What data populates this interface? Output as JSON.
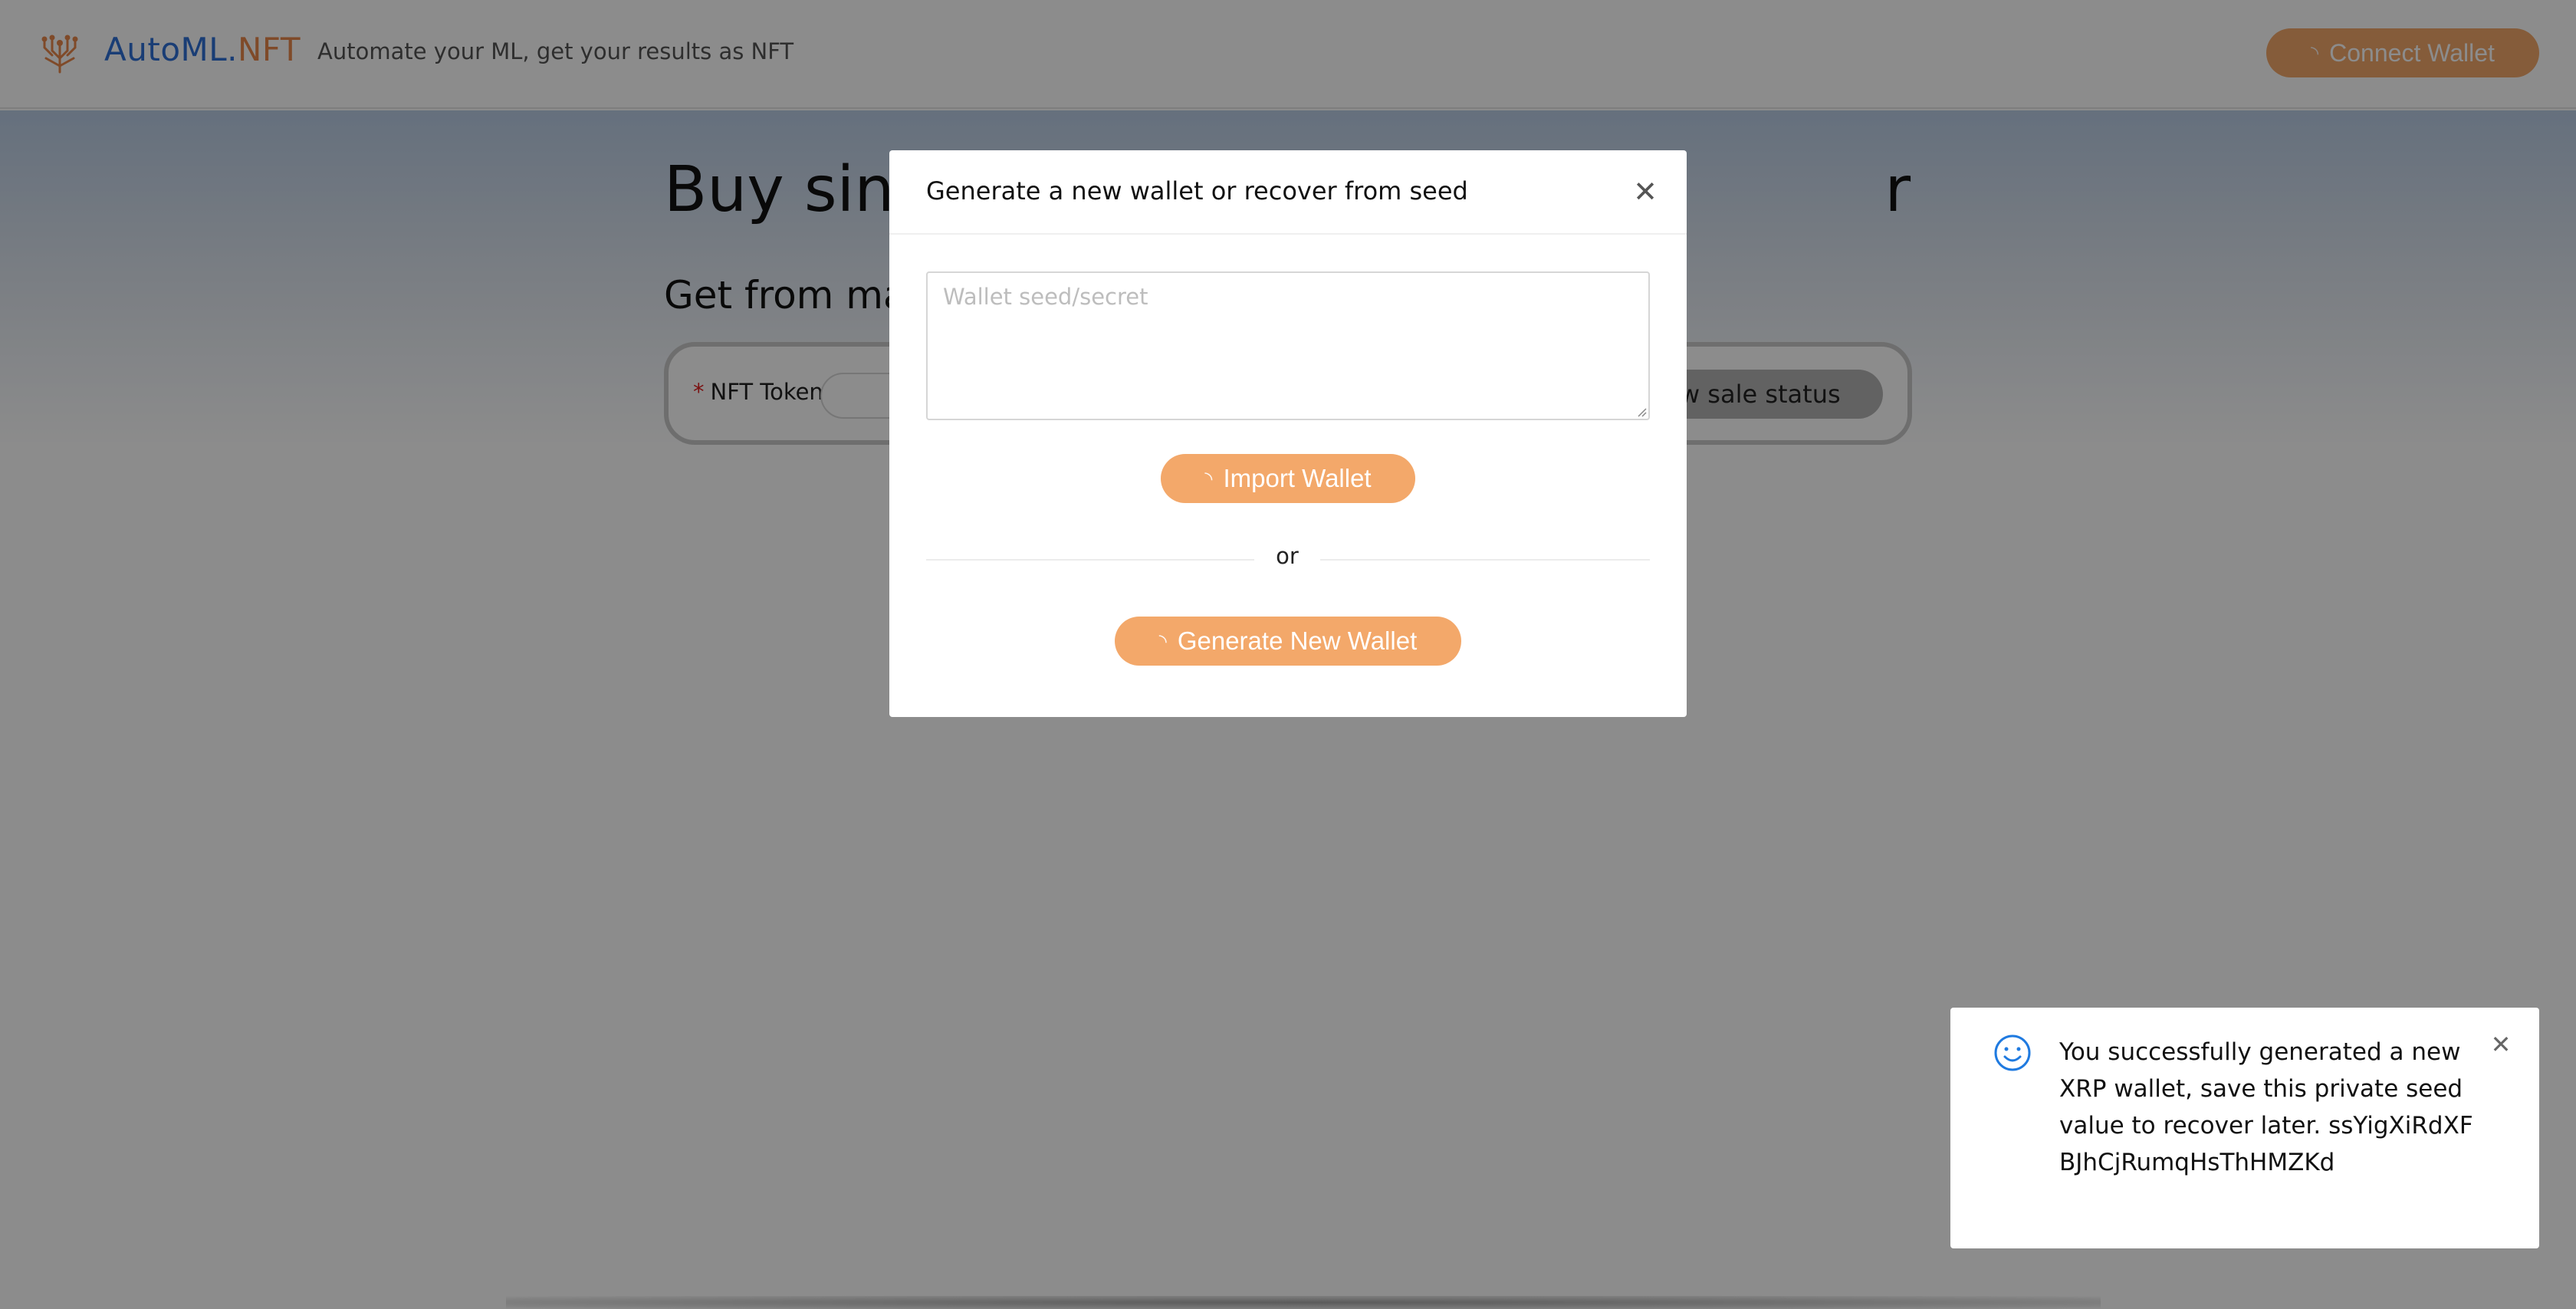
{
  "header": {
    "brand_main": "AutoML.",
    "brand_accent": "NFT",
    "tagline": "Automate your ML, get your results as NFT",
    "connect_wallet_label": "Connect Wallet"
  },
  "page": {
    "title": "Buy sing",
    "title_tail": "r",
    "subtitle": "Get from mar",
    "form": {
      "nft_token_label": "NFT Tokenl",
      "show_sale_status_label": "ow sale status"
    }
  },
  "modal": {
    "title": "Generate a new wallet or recover from seed",
    "close_glyph": "✕",
    "seed_placeholder": "Wallet seed/secret",
    "import_label": "Import Wallet",
    "divider_text": "or",
    "generate_label": "Generate New Wallet"
  },
  "notification": {
    "message": "You successfully generated a new XRP wallet, save this private seed value to recover later. ssYigXiRdXFBJhCjRumqHsThHMZKd",
    "close_glyph": "✕",
    "icon": "smile-icon"
  },
  "colors": {
    "accent_orange": "#f3a86a",
    "brand_blue": "#2f6fd6",
    "brand_orange": "#e8884b",
    "info_blue": "#1f7ae0"
  }
}
